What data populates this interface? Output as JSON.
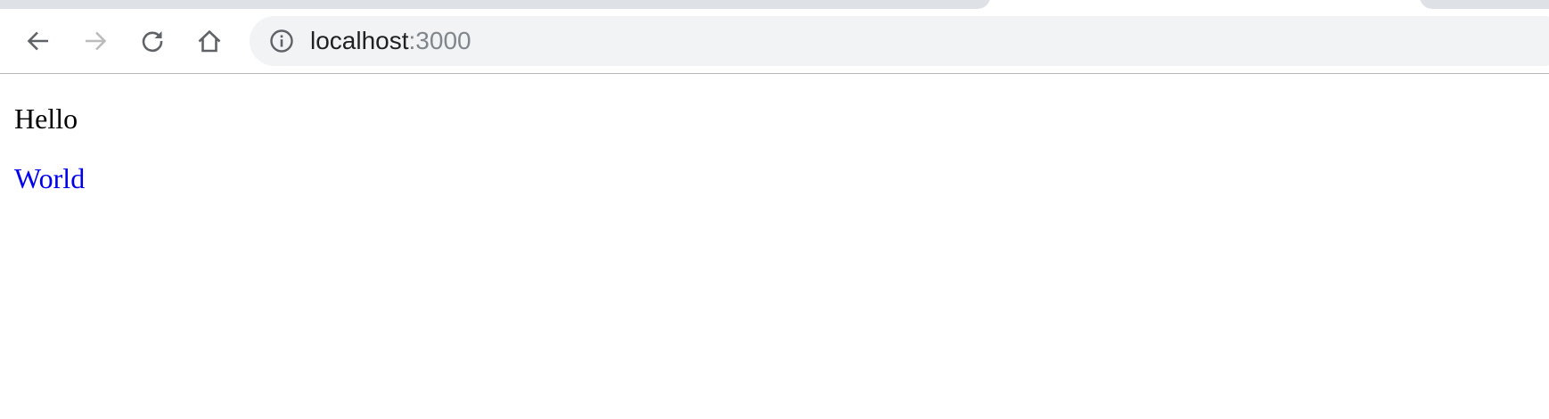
{
  "browser": {
    "address_bar": {
      "host": "localhost",
      "port": ":3000"
    },
    "icons": {
      "back": "arrow-left-icon",
      "forward": "arrow-right-icon",
      "reload": "reload-icon",
      "home": "home-icon",
      "site_info": "info-icon"
    },
    "colors": {
      "toolbar_bg": "#ffffff",
      "omnibox_bg": "#f1f3f4",
      "tab_inactive": "#dee1e6",
      "icon_active": "#5f6368",
      "icon_disabled": "#babcbe",
      "url_port": "#80868b"
    },
    "forward_enabled": false
  },
  "page": {
    "heading_text": "Hello",
    "link_text": "World",
    "colors": {
      "text": "#000000",
      "link": "#0000ee"
    }
  }
}
